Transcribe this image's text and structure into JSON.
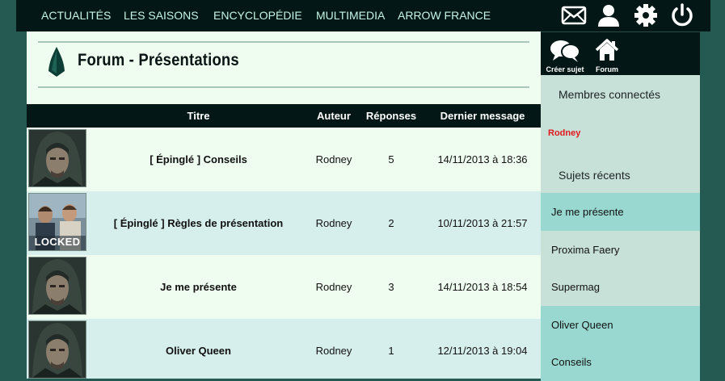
{
  "nav": {
    "links": [
      "ACTUALITÉS",
      "LES SAISONS",
      "ENCYCLOPÉDIE",
      "MULTIMEDIA",
      "ARROW FRANCE"
    ],
    "icons": [
      "mail-icon",
      "user-icon",
      "gear-icon",
      "power-icon"
    ]
  },
  "forum": {
    "title": "Forum - Présentations",
    "columns": {
      "title": "Titre",
      "author": "Auteur",
      "replies": "Réponses",
      "last": "Dernier message"
    },
    "topics": [
      {
        "title": "[ Épinglé ] Conseils",
        "author": "Rodney",
        "replies": "5",
        "last": "14/11/2013 à 18:36",
        "thumb": "hood-avatar"
      },
      {
        "title": "[ Épinglé ] Règles de présentation",
        "author": "Rodney",
        "replies": "2",
        "last": "10/11/2013 à 21:57",
        "thumb": "locked-photo",
        "thumb_text": "LOCKED"
      },
      {
        "title": "Je me présente",
        "author": "Rodney",
        "replies": "3",
        "last": "14/11/2013 à 18:54",
        "thumb": "hood-avatar"
      },
      {
        "title": "Oliver Queen",
        "author": "Rodney",
        "replies": "1",
        "last": "12/11/2013 à 19:04",
        "thumb": "hood-avatar"
      }
    ]
  },
  "sidebar": {
    "new_topic_label": "Créer sujet",
    "forum_label": "Forum",
    "online_heading": "Membres connectés",
    "online_users": [
      "Rodney"
    ],
    "recent_heading": "Sujets récents",
    "recent_topics": [
      "Je me présente",
      "Proxima Faery",
      "Supermag",
      "Oliver Queen",
      "Conseils"
    ]
  },
  "colors": {
    "topbar": "#031716",
    "page_bg": "#245a52",
    "content_bg": "#eefdf0",
    "row_alt": "#d7efec",
    "nav_text": "#c6f4e4",
    "online_user": "#e0181c"
  }
}
